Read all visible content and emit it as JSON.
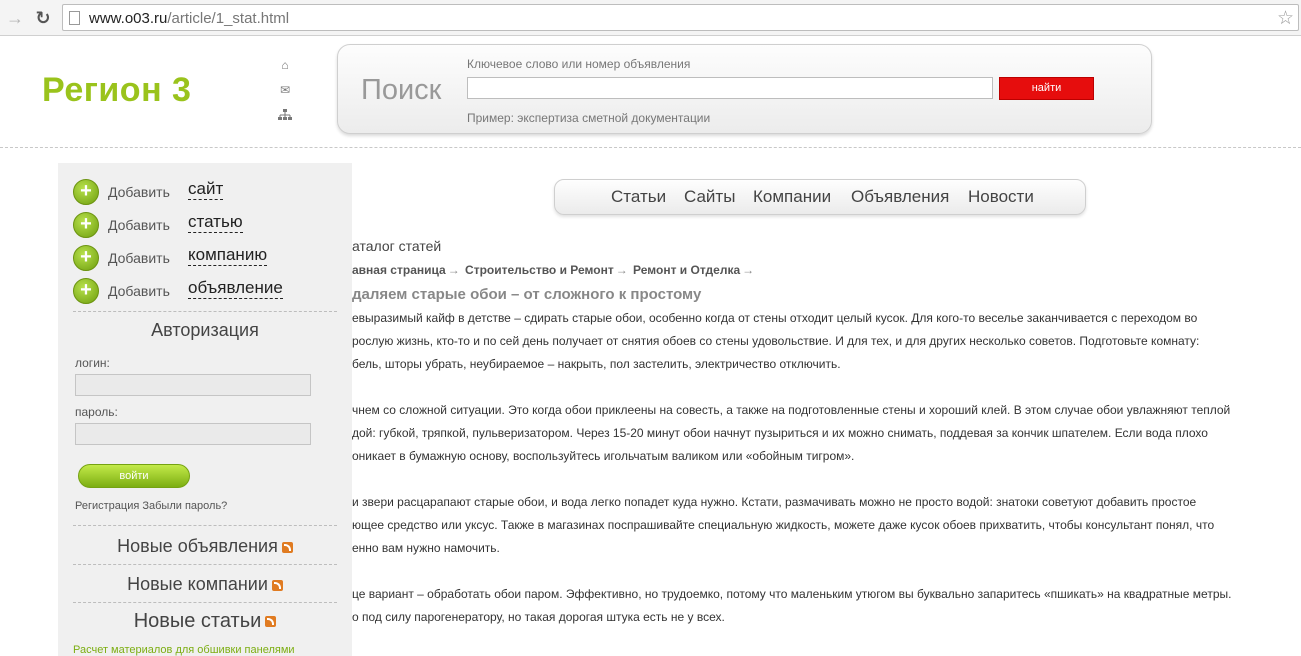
{
  "browser": {
    "url_host": "www.o03.ru",
    "url_path": "/article/1_stat.html"
  },
  "header": {
    "logo": "Регион 3",
    "icons": [
      "home-icon",
      "mail-icon",
      "sitemap-icon"
    ]
  },
  "search": {
    "title": "Поиск",
    "hint": "Ключевое слово или номер объявления",
    "input_value": "",
    "button": "найти",
    "example": "Пример: экспертиза сметной документации"
  },
  "sidebar": {
    "add_prefix": "Добавить",
    "add_items": [
      "сайт",
      "статью",
      "компанию",
      "объявление"
    ],
    "auth_title": "Авторизация",
    "login_label": "логин:",
    "password_label": "пароль:",
    "login_button": "войти",
    "register_link": "Регистрация",
    "forgot_link": "Забыли пароль?",
    "feeds": [
      "Новые объявления",
      "Новые компании",
      "Новые статьи"
    ],
    "footer_link": "Расчет материалов для обшивки панелями"
  },
  "menu": {
    "items": [
      "Статьи",
      "Сайты",
      "Компании",
      "Объявления",
      "Новости"
    ]
  },
  "article": {
    "catalog": "аталог статей",
    "breadcrumbs": [
      "авная страница",
      "Строительство и Ремонт",
      "Ремонт и Отделка"
    ],
    "title": "даляем старые обои – от сложного к простому",
    "lines": [
      "евыразимый кайф в детстве – сдирать старые обои, особенно когда от стены отходит целый кусок. Для кого-то веселье заканчивается с переходом во",
      "рослую жизнь, кто-то и по сей день получает от снятия обоев со стены удовольствие. И для тех, и для других несколько советов. Подготовьте комнату:",
      "бель, шторы убрать, неубираемое – накрыть, пол застелить, электричество отключить.",
      "чнем со сложной ситуации. Это когда обои приклеены на совесть, а также на подготовленные стены и хороший клей. В этом случае обои увлажняют теплой",
      "дой: губкой, тряпкой, пульверизатором. Через 15-20 минут обои начнут пузыриться и их можно снимать, поддевая за кончик шпателем. Если вода плохо",
      "оникает в бумажную основу, воспользуйтесь игольчатым валиком или «обойным тигром».",
      "и звери расцарапают старые обои, и вода легко попадет куда нужно. Кстати, размачивать можно не просто водой: знатоки советуют добавить простое",
      "ющее средство или уксус. Также в магазинах поспрашивайте специальную жидкость, можете даже кусок обоев прихватить, чтобы консультант понял, что",
      "енно вам нужно намочить.",
      "це вариант – обработать обои паром. Эффективно, но трудоемко, потому что маленьким утюгом вы буквально запаритесь «пшикать» на квадратные метры.",
      "о под силу парогенератору, но такая дорогая штука есть не у всех."
    ]
  }
}
